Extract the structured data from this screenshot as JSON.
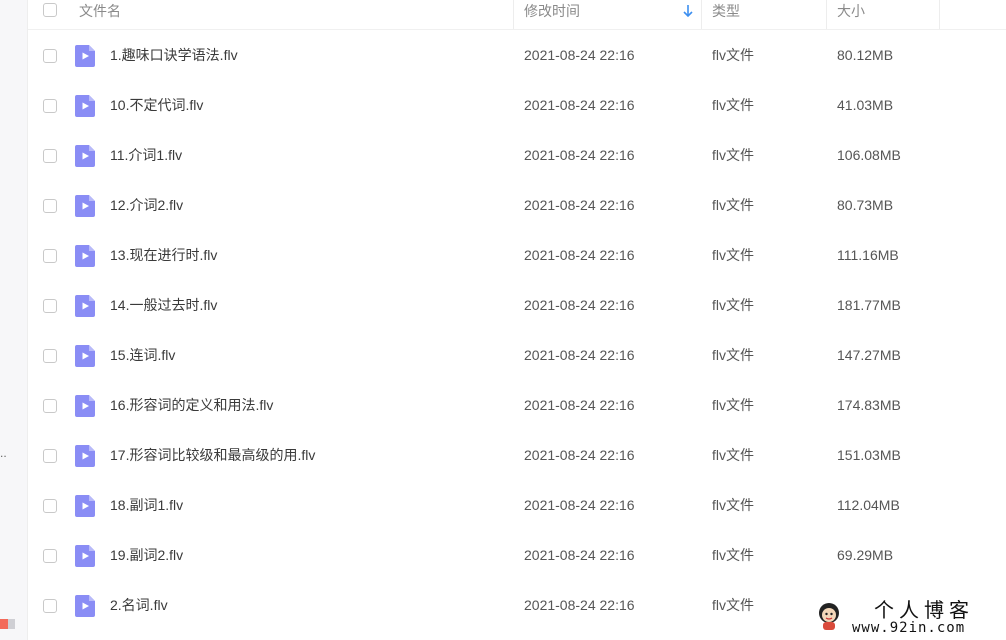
{
  "header": {
    "col_name": "文件名",
    "col_modified": "修改时间",
    "col_type": "类型",
    "col_size": "大小"
  },
  "colors": {
    "file_icon": "#8a8df5",
    "sort_arrow": "#3c8ff0"
  },
  "files": [
    {
      "name": "1.趣味口诀学语法.flv",
      "modified": "2021-08-24 22:16",
      "type": "flv文件",
      "size": "80.12MB"
    },
    {
      "name": "10.不定代词.flv",
      "modified": "2021-08-24 22:16",
      "type": "flv文件",
      "size": "41.03MB"
    },
    {
      "name": "11.介词1.flv",
      "modified": "2021-08-24 22:16",
      "type": "flv文件",
      "size": "106.08MB"
    },
    {
      "name": "12.介词2.flv",
      "modified": "2021-08-24 22:16",
      "type": "flv文件",
      "size": "80.73MB"
    },
    {
      "name": "13.现在进行时.flv",
      "modified": "2021-08-24 22:16",
      "type": "flv文件",
      "size": "111.16MB"
    },
    {
      "name": "14.一般过去时.flv",
      "modified": "2021-08-24 22:16",
      "type": "flv文件",
      "size": "181.77MB"
    },
    {
      "name": "15.连词.flv",
      "modified": "2021-08-24 22:16",
      "type": "flv文件",
      "size": "147.27MB"
    },
    {
      "name": "16.形容词的定义和用法.flv",
      "modified": "2021-08-24 22:16",
      "type": "flv文件",
      "size": "174.83MB"
    },
    {
      "name": "17.形容词比较级和最高级的用.flv",
      "modified": "2021-08-24 22:16",
      "type": "flv文件",
      "size": "151.03MB"
    },
    {
      "name": "18.副词1.flv",
      "modified": "2021-08-24 22:16",
      "type": "flv文件",
      "size": "112.04MB"
    },
    {
      "name": "19.副词2.flv",
      "modified": "2021-08-24 22:16",
      "type": "flv文件",
      "size": "69.29MB"
    },
    {
      "name": "2.名词.flv",
      "modified": "2021-08-24 22:16",
      "type": "flv文件",
      "size": ""
    }
  ],
  "sidebar": {
    "ellipsis": ".."
  },
  "watermark": {
    "title": "个人博客",
    "url": "www.92in.com"
  }
}
